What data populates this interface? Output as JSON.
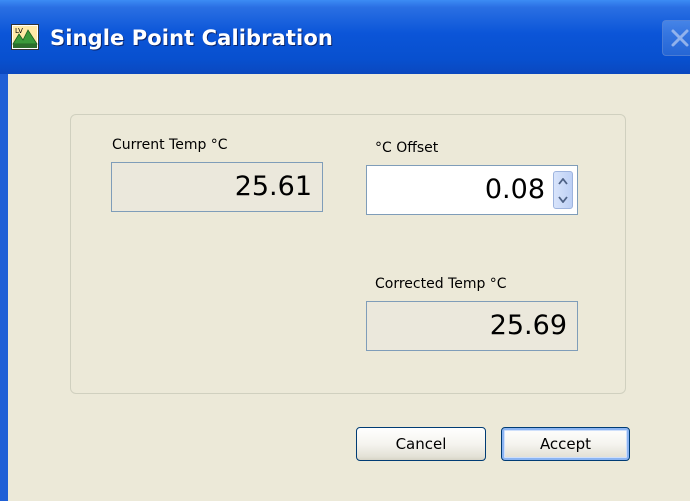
{
  "window": {
    "title": "Single Point Calibration",
    "app_icon": "lv-app-icon",
    "close_icon": "close-icon"
  },
  "fields": {
    "current_temp": {
      "label": "Current Temp °C",
      "value": "25.61"
    },
    "offset": {
      "label": "°C Offset",
      "value": "0.08"
    },
    "corrected_temp": {
      "label": "Corrected Temp °C",
      "value": "25.69"
    }
  },
  "buttons": {
    "cancel": "Cancel",
    "accept": "Accept"
  },
  "colors": {
    "titlebar": "#0b55d8",
    "dialog_bg": "#ece9d8",
    "readonly_bg": "#ebe8dc",
    "input_border": "#7f9db9"
  }
}
